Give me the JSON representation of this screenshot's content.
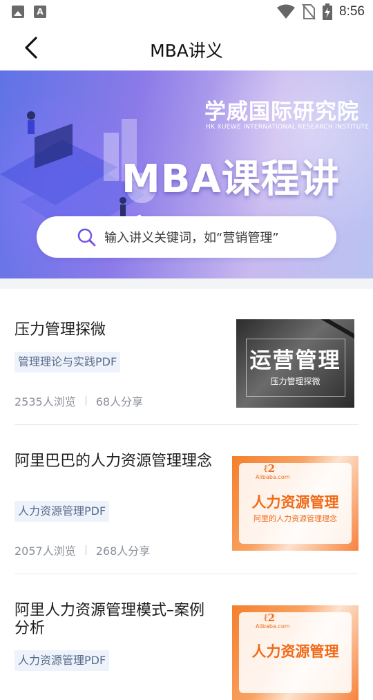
{
  "status_bar": {
    "time": "8:56",
    "left_icons": [
      "image-icon",
      "font-a-icon"
    ],
    "right_icons": [
      "wifi-icon",
      "no-sim-icon",
      "battery-charging-icon"
    ],
    "font_icon_letter": "A"
  },
  "header": {
    "title": "MBA讲义",
    "back_icon": "chevron-left-icon"
  },
  "banner": {
    "institute": "学威国际研究院",
    "institute_en": "HK XUEWE INTERNATIONAL RESEARCH INSTITUTE",
    "headline": "MBA课程讲义",
    "gradient_colors": [
      "#5f73e6",
      "#8b7ae8",
      "#c9b9ef"
    ]
  },
  "search": {
    "placeholder": "输入讲义关键词，如“营销管理”",
    "icon": "search-icon",
    "icon_colors": [
      "#4a55e8",
      "#9a57e3"
    ]
  },
  "list": [
    {
      "title": "压力管理探微",
      "tag": "管理理论与实践PDF",
      "views": "2535人浏览",
      "shares": "68人分享",
      "thumb": {
        "style": "dark",
        "heading": "运营管理",
        "subheading": "压力管理探微"
      }
    },
    {
      "title": "阿里巴巴的人力资源管理理念",
      "tag": "人力资源管理PDF",
      "views": "2057人浏览",
      "shares": "268人分享",
      "thumb": {
        "style": "orange",
        "logo_text": "Alibaba.com",
        "heading": "人力资源管理",
        "subheading": "阿里的人力资源管理理念"
      }
    },
    {
      "title": "阿里人力资源管理模式–案例分析",
      "tag": "人力资源管理PDF",
      "thumb": {
        "style": "orange",
        "logo_text": "Alibaba.com",
        "heading": "人力资源管理"
      }
    }
  ],
  "colors": {
    "tag_bg": "#eef3fb",
    "tag_text": "#596a8a",
    "stats_text": "#8a8f99",
    "orange_accent": "#f06a18"
  }
}
